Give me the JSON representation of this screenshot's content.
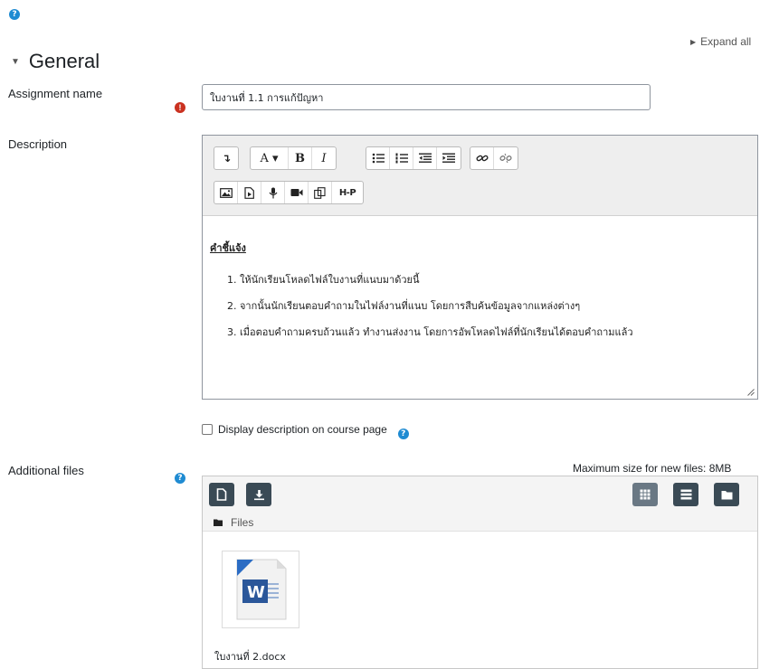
{
  "top_help": {
    "icon": "help-icon"
  },
  "expand_all": {
    "label": "Expand all"
  },
  "section": {
    "title": "General"
  },
  "assignment_name": {
    "label": "Assignment name",
    "value": "ใบงานที่ 1.1 การแก้ปัญหา"
  },
  "description": {
    "label": "Description",
    "toolbar_row1": [
      "↴",
      "A ▾",
      "B",
      "I",
      "bullet-list",
      "numbered-list",
      "outdent",
      "indent",
      "link",
      "unlink"
    ],
    "toolbar_row2": [
      "image",
      "media",
      "record-audio",
      "record-video",
      "manage-files",
      "H-P"
    ],
    "h5p_label": "H-P",
    "heading": "คำชี้แจ้ง",
    "items": [
      "1. ให้นักเรียนโหลดไฟล์ใบงานที่แนบมาด้วยนี้",
      "2. จากนั้นนักเรียนตอบคำถามในไฟล์งานที่แนบ โดยการสืบค้นข้อมูลจากแหล่งต่างๆ",
      "3. เมื่อตอบคำถามครบถ้วนแล้ว ทำงานส่งงาน โดยการอัพโหลดไฟล์ที่นักเรียนได้ตอบคำถามแล้ว"
    ]
  },
  "display_on_course": {
    "label": "Display description on course page",
    "checked": false
  },
  "additional_files": {
    "label": "Additional files",
    "max_size": "Maximum size for new files: 8MB",
    "path_label": "Files",
    "files": [
      {
        "name": "ใบงานที่ 2.docx",
        "icon": "word-document-icon"
      }
    ]
  },
  "colors": {
    "help": "#1f8bd2",
    "required": "#ca3120",
    "dark_button": "#3a4a55",
    "word_blue": "#2b579a"
  }
}
